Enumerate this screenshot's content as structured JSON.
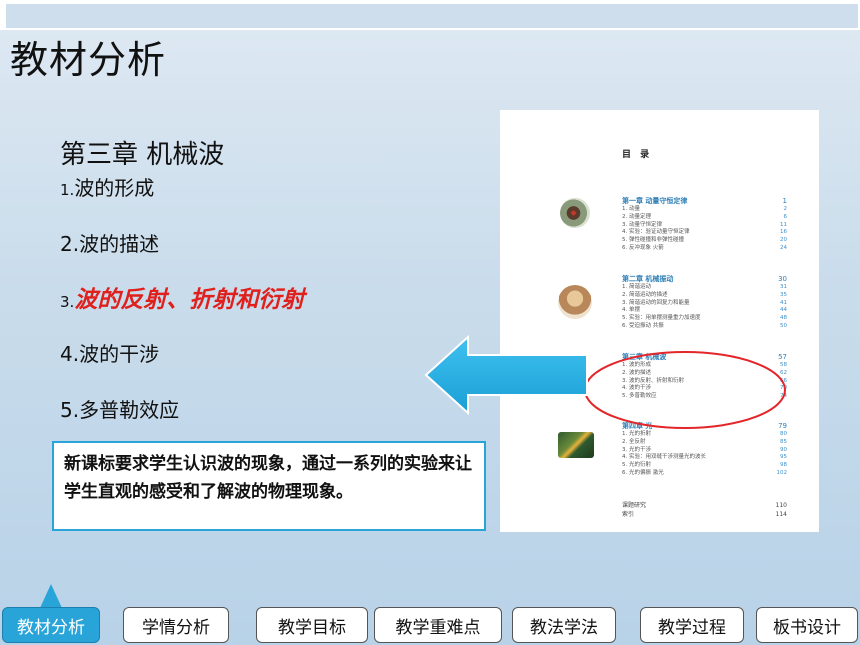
{
  "page_title": "教材分析",
  "chapter": {
    "title": "第三章  机械波"
  },
  "topics": [
    {
      "num": "1.",
      "text": "波的形成"
    },
    {
      "num": "2.",
      "text": "波的描述"
    },
    {
      "num": "3.",
      "text": "波的反射、折射和衍射"
    },
    {
      "num": "4.",
      "text": "波的干涉"
    },
    {
      "num": "5.",
      "text": "多普勒效应"
    }
  ],
  "note": "新课标要求学生认识波的现象，通过一系列的实验来让学生直观的感受和了解波的物理现象。",
  "toc": {
    "heading": "目 录",
    "chapters": [
      {
        "title": "第一章   动量守恒定律",
        "page": "1",
        "items": [
          {
            "t": "1. 动量",
            "p": "2"
          },
          {
            "t": "2. 动量定理",
            "p": "6"
          },
          {
            "t": "3. 动量守恒定律",
            "p": "11"
          },
          {
            "t": "4. 实验：验证动量守恒定律",
            "p": "16"
          },
          {
            "t": "5. 弹性碰撞和非弹性碰撞",
            "p": "20"
          },
          {
            "t": "6. 反冲现象  火箭",
            "p": "24"
          }
        ]
      },
      {
        "title": "第二章   机械振动",
        "page": "30",
        "items": [
          {
            "t": "1. 简谐运动",
            "p": "31"
          },
          {
            "t": "2. 简谐运动的描述",
            "p": "35"
          },
          {
            "t": "3. 简谐运动的回复力和能量",
            "p": "41"
          },
          {
            "t": "4. 单摆",
            "p": "44"
          },
          {
            "t": "5. 实验：用单摆测量重力加速度",
            "p": "48"
          },
          {
            "t": "6. 受迫振动  共振",
            "p": "50"
          }
        ]
      },
      {
        "title": "第三章   机械波",
        "page": "57",
        "items": [
          {
            "t": "1. 波的形成",
            "p": "58"
          },
          {
            "t": "2. 波的描述",
            "p": "62"
          },
          {
            "t": "3. 波的反射、折射和衍射",
            "p": "66"
          },
          {
            "t": "4. 波的干涉",
            "p": "70"
          },
          {
            "t": "5. 多普勒效应",
            "p": "74"
          }
        ]
      },
      {
        "title": "第四章   光",
        "page": "79",
        "items": [
          {
            "t": "1. 光的折射",
            "p": "80"
          },
          {
            "t": "2. 全反射",
            "p": "85"
          },
          {
            "t": "3. 光的干涉",
            "p": "90"
          },
          {
            "t": "4. 实验：用双缝干涉测量光的波长",
            "p": "95"
          },
          {
            "t": "5. 光的衍射",
            "p": "98"
          },
          {
            "t": "6. 光的偏振  激光",
            "p": "102"
          }
        ]
      }
    ],
    "extras": [
      {
        "t": "课题研究",
        "p": "110"
      },
      {
        "t": "索引",
        "p": "114"
      }
    ]
  },
  "nav": [
    {
      "label": "教材分析",
      "active": true
    },
    {
      "label": "学情分析",
      "active": false
    },
    {
      "label": "教学目标",
      "active": false
    },
    {
      "label": "教学重难点",
      "active": false
    },
    {
      "label": "教法学法",
      "active": false
    },
    {
      "label": "教学过程",
      "active": false
    },
    {
      "label": "板书设计",
      "active": false
    }
  ],
  "colors": {
    "accent": "#29a4d8",
    "highlight": "#e0201d",
    "oval": "#e3262a"
  }
}
